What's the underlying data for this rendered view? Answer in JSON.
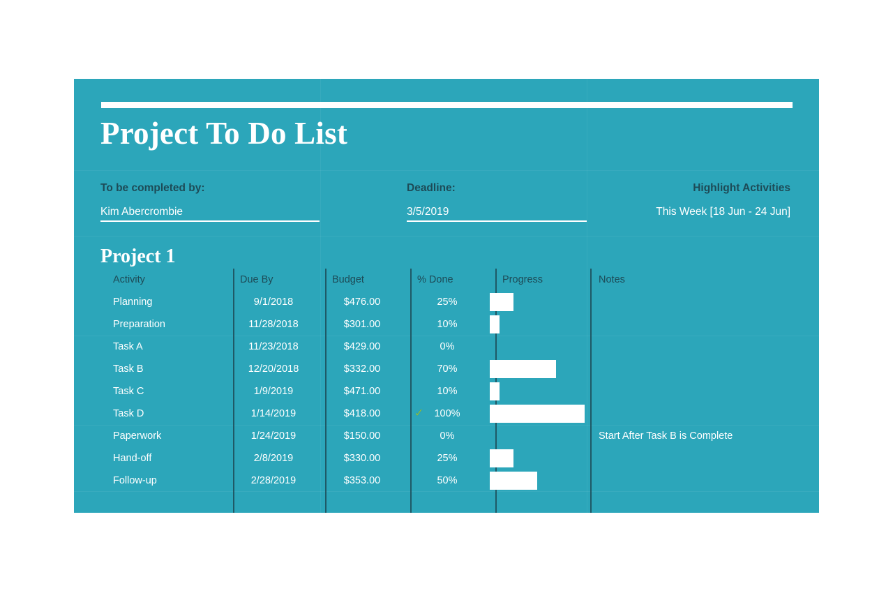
{
  "document": {
    "title": "Project To Do List",
    "accent_color": "#2CA6BA",
    "dark_text_color": "#1D4B57",
    "light_text_color": "#FFFFFF",
    "check_color": "#8FBF3F"
  },
  "meta": {
    "completed_by_label": "To be completed by:",
    "completed_by_value": "Kim Abercrombie",
    "deadline_label": "Deadline:",
    "deadline_value": "3/5/2019",
    "highlight_label": "Highlight Activities",
    "highlight_value": "This Week [18 Jun - 24 Jun]"
  },
  "project": {
    "name": "Project 1",
    "columns": [
      "Activity",
      "Due By",
      "Budget",
      "% Done",
      "Progress",
      "Notes"
    ],
    "rows": [
      {
        "activity": "Planning",
        "due_by": "9/1/2018",
        "budget": "$476.00",
        "percent_done": "25%",
        "percent_value": 25,
        "notes": "",
        "complete_icon": ""
      },
      {
        "activity": "Preparation",
        "due_by": "11/28/2018",
        "budget": "$301.00",
        "percent_done": "10%",
        "percent_value": 10,
        "notes": "",
        "complete_icon": ""
      },
      {
        "activity": "Task A",
        "due_by": "11/23/2018",
        "budget": "$429.00",
        "percent_done": "0%",
        "percent_value": 0,
        "notes": "",
        "complete_icon": ""
      },
      {
        "activity": "Task B",
        "due_by": "12/20/2018",
        "budget": "$332.00",
        "percent_done": "70%",
        "percent_value": 70,
        "notes": "",
        "complete_icon": ""
      },
      {
        "activity": "Task C",
        "due_by": "1/9/2019",
        "budget": "$471.00",
        "percent_done": "10%",
        "percent_value": 10,
        "notes": "",
        "complete_icon": ""
      },
      {
        "activity": "Task D",
        "due_by": "1/14/2019",
        "budget": "$418.00",
        "percent_done": "100%",
        "percent_value": 100,
        "notes": "",
        "complete_icon": "✓"
      },
      {
        "activity": "Paperwork",
        "due_by": "1/24/2019",
        "budget": "$150.00",
        "percent_done": "0%",
        "percent_value": 0,
        "notes": "Start After Task B is Complete",
        "complete_icon": ""
      },
      {
        "activity": "Hand-off",
        "due_by": "2/8/2019",
        "budget": "$330.00",
        "percent_done": "25%",
        "percent_value": 25,
        "notes": "",
        "complete_icon": ""
      },
      {
        "activity": "Follow-up",
        "due_by": "2/28/2019",
        "budget": "$353.00",
        "percent_done": "50%",
        "percent_value": 50,
        "notes": "",
        "complete_icon": ""
      }
    ]
  }
}
